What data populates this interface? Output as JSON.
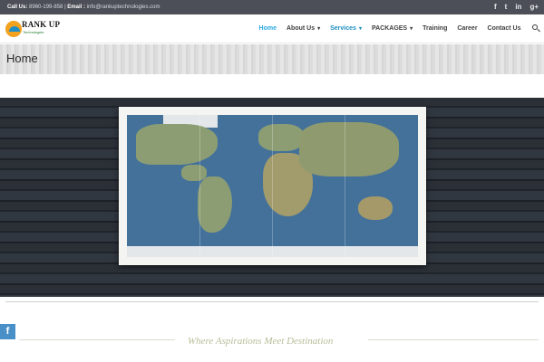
{
  "topbar": {
    "call_label": "Call Us:",
    "phone": "8960-199-858",
    "separator": "|",
    "email_label": "Email :",
    "email": "info@rankuptechnologies.com",
    "social": [
      {
        "name": "facebook-icon",
        "glyph": "f"
      },
      {
        "name": "twitter-icon",
        "glyph": "t"
      },
      {
        "name": "linkedin-icon",
        "glyph": "in"
      },
      {
        "name": "google-plus-icon",
        "glyph": "g+"
      }
    ]
  },
  "logo": {
    "brand": "RANK UP",
    "tagline": "Technologies"
  },
  "nav": {
    "items": [
      {
        "label": "Home",
        "dropdown": false
      },
      {
        "label": "About Us",
        "dropdown": true
      },
      {
        "label": "Services",
        "dropdown": true
      },
      {
        "label": "PACKAGES",
        "dropdown": true
      },
      {
        "label": "Training",
        "dropdown": false
      },
      {
        "label": "Career",
        "dropdown": false
      },
      {
        "label": "Contact Us",
        "dropdown": false
      }
    ],
    "caret": "▾"
  },
  "page": {
    "title": "Home"
  },
  "widget": {
    "facebook_glyph": "f"
  },
  "section": {
    "tagline": "Where Aspirations Meet Destination"
  },
  "colors": {
    "topbar_bg": "#4c4f58",
    "accent": "#29a9df",
    "tagline": "#b7bc98",
    "facebook_widget": "#4a90c8"
  }
}
